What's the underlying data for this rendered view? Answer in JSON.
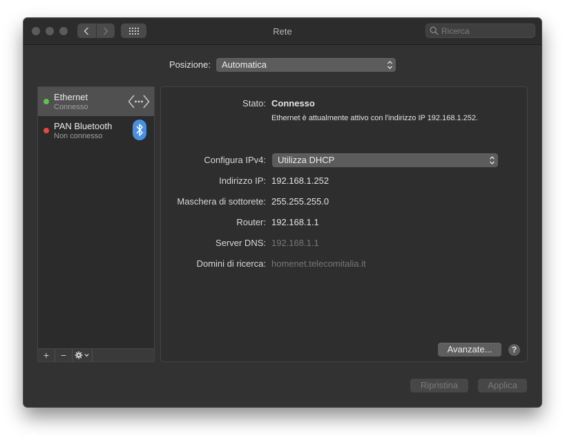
{
  "window": {
    "title": "Rete"
  },
  "search": {
    "placeholder": "Ricerca"
  },
  "location": {
    "label": "Posizione:",
    "value": "Automatica"
  },
  "services": [
    {
      "name": "Ethernet",
      "status": "Connesso",
      "status_color": "#5ec34f",
      "icon": "ethernet-arrows-icon",
      "selected": true
    },
    {
      "name": "PAN Bluetooth",
      "status": "Non connesso",
      "status_color": "#e4493f",
      "icon": "bluetooth-icon",
      "selected": false
    }
  ],
  "sidebar_toolbar": {
    "add": "+",
    "remove": "−"
  },
  "detail": {
    "status_label": "Stato:",
    "status_value": "Connesso",
    "status_desc": "Ethernet è attualmente attivo con l'indirizzo IP 192.168.1.252.",
    "ipv4_label": "Configura IPv4:",
    "ipv4_value": "Utilizza DHCP",
    "ip_label": "Indirizzo IP:",
    "ip_value": "192.168.1.252",
    "mask_label": "Maschera di sottorete:",
    "mask_value": "255.255.255.0",
    "router_label": "Router:",
    "router_value": "192.168.1.1",
    "dns_label": "Server DNS:",
    "dns_value": "192.168.1.1",
    "domains_label": "Domini di ricerca:",
    "domains_value": "homenet.telecomitalia.it",
    "advanced": "Avanzate...",
    "help": "?"
  },
  "footer": {
    "revert": "Ripristina",
    "apply": "Applica"
  },
  "colors": {
    "bluetooth_badge": "#4a90e2",
    "window_bg": "#323232"
  }
}
